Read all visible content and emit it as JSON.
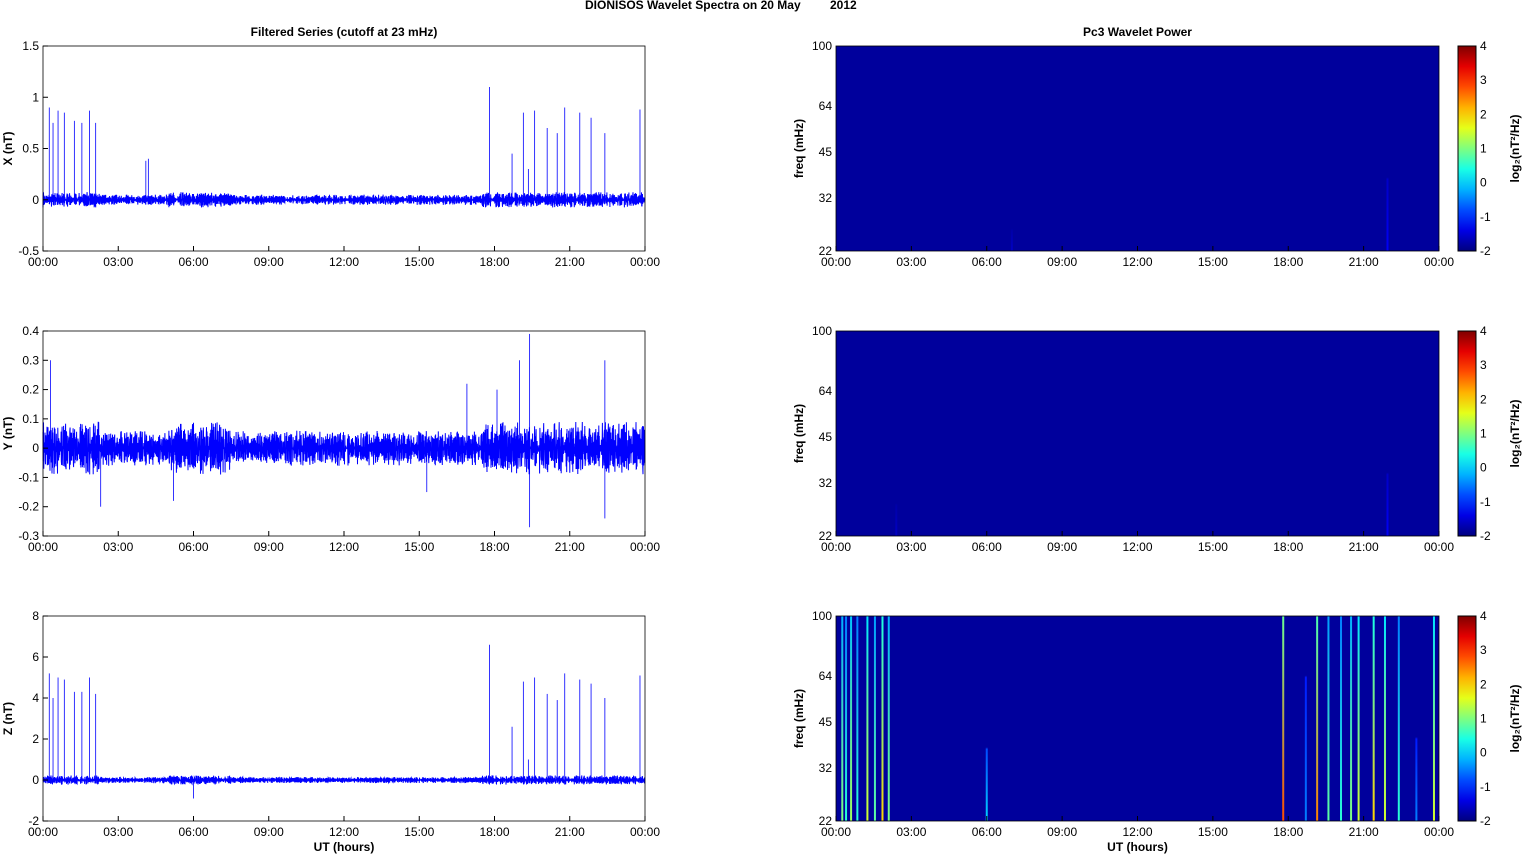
{
  "title": "DIONISOS Wavelet Spectra on 20 May",
  "year": "2012",
  "chart_data": [
    {
      "type": "line",
      "title": "Filtered Series (cutoff at 23 mHz)",
      "ylabel": "X (nT)",
      "xlabel": "",
      "ylim": [
        -0.5,
        1.5
      ],
      "yticks": [
        "-0.5",
        "0",
        "0.5",
        "1",
        "1.5"
      ],
      "xticks": [
        "00:00",
        "03:00",
        "06:00",
        "09:00",
        "12:00",
        "15:00",
        "18:00",
        "21:00",
        "00:00"
      ],
      "noise": 0.05,
      "color": "#0000ff",
      "spikes": [
        [
          0.25,
          0.9
        ],
        [
          0.4,
          0.75
        ],
        [
          0.6,
          0.87
        ],
        [
          0.85,
          0.85
        ],
        [
          1.25,
          0.77
        ],
        [
          1.55,
          0.75
        ],
        [
          1.85,
          0.87
        ],
        [
          2.1,
          0.75
        ],
        [
          4.1,
          0.38
        ],
        [
          4.2,
          0.4
        ],
        [
          17.8,
          1.1
        ],
        [
          18.7,
          0.45
        ],
        [
          19.15,
          0.85
        ],
        [
          19.35,
          0.3
        ],
        [
          19.6,
          0.87
        ],
        [
          20.1,
          0.7
        ],
        [
          20.5,
          0.65
        ],
        [
          20.8,
          0.9
        ],
        [
          21.4,
          0.85
        ],
        [
          21.85,
          0.8
        ],
        [
          22.4,
          0.65
        ],
        [
          23.8,
          0.88
        ]
      ]
    },
    {
      "type": "line",
      "title": "",
      "ylabel": "Y (nT)",
      "xlabel": "",
      "ylim": [
        -0.3,
        0.4
      ],
      "yticks": [
        "-0.3",
        "-0.2",
        "-0.1",
        "0",
        "0.1",
        "0.2",
        "0.3",
        "0.4"
      ],
      "xticks": [
        "00:00",
        "03:00",
        "06:00",
        "09:00",
        "12:00",
        "15:00",
        "18:00",
        "21:00",
        "00:00"
      ],
      "noise": 0.06,
      "color": "#0000ff",
      "spikes": [
        [
          0.3,
          0.3
        ],
        [
          2.3,
          -0.2
        ],
        [
          5.2,
          -0.18
        ],
        [
          15.3,
          -0.15
        ],
        [
          16.9,
          0.22
        ],
        [
          18.1,
          0.2
        ],
        [
          19.0,
          0.3
        ],
        [
          19.4,
          0.39
        ],
        [
          19.4,
          -0.27
        ],
        [
          22.4,
          0.3
        ],
        [
          22.4,
          -0.24
        ]
      ]
    },
    {
      "type": "line",
      "title": "",
      "ylabel": "Z (nT)",
      "xlabel": "UT (hours)",
      "ylim": [
        -2,
        8
      ],
      "yticks": [
        "-2",
        "0",
        "2",
        "4",
        "6",
        "8"
      ],
      "xticks": [
        "00:00",
        "03:00",
        "06:00",
        "09:00",
        "12:00",
        "15:00",
        "18:00",
        "21:00",
        "00:00"
      ],
      "noise": 0.15,
      "color": "#0000ff",
      "spikes": [
        [
          0.25,
          5.2
        ],
        [
          0.4,
          4.0
        ],
        [
          0.6,
          5.0
        ],
        [
          0.85,
          4.9
        ],
        [
          1.25,
          4.3
        ],
        [
          1.55,
          4.3
        ],
        [
          1.85,
          5.0
        ],
        [
          2.1,
          4.2
        ],
        [
          6.0,
          -0.9
        ],
        [
          17.8,
          6.6
        ],
        [
          18.7,
          2.6
        ],
        [
          19.15,
          4.8
        ],
        [
          19.35,
          1.0
        ],
        [
          19.6,
          5.0
        ],
        [
          20.1,
          4.2
        ],
        [
          20.5,
          3.9
        ],
        [
          20.8,
          5.2
        ],
        [
          21.4,
          4.9
        ],
        [
          21.85,
          4.7
        ],
        [
          22.4,
          4.0
        ],
        [
          23.8,
          5.1
        ]
      ]
    },
    {
      "type": "heatmap",
      "title": "Pc3 Wavelet Power",
      "ylabel": "freq (mHz)",
      "xlabel": "",
      "yticks": [
        "100",
        "64",
        "45",
        "32",
        "22"
      ],
      "xticks": [
        "00:00",
        "03:00",
        "06:00",
        "09:00",
        "12:00",
        "15:00",
        "18:00",
        "21:00",
        "00:00"
      ],
      "colorbar": {
        "label": "log2(nT2/Hz)",
        "range": [
          -2,
          4
        ],
        "ticks": [
          "4",
          "3",
          "2",
          "1",
          "0",
          "-1",
          "-2"
        ]
      },
      "streaks": [
        [
          7.0,
          -1.6,
          0.1
        ],
        [
          21.95,
          -1.3,
          0.35
        ]
      ]
    },
    {
      "type": "heatmap",
      "title": "",
      "ylabel": "freq (mHz)",
      "xlabel": "",
      "yticks": [
        "100",
        "64",
        "45",
        "32",
        "22"
      ],
      "xticks": [
        "00:00",
        "03:00",
        "06:00",
        "09:00",
        "12:00",
        "15:00",
        "18:00",
        "21:00",
        "00:00"
      ],
      "colorbar": {
        "label": "log2(nT2/Hz)",
        "range": [
          -2,
          4
        ],
        "ticks": [
          "4",
          "3",
          "2",
          "1",
          "0",
          "-1",
          "-2"
        ]
      },
      "streaks": [
        [
          2.4,
          -1.6,
          0.15
        ],
        [
          21.95,
          -1.3,
          0.3
        ]
      ]
    },
    {
      "type": "heatmap",
      "title": "",
      "ylabel": "freq (mHz)",
      "xlabel": "UT (hours)",
      "yticks": [
        "100",
        "64",
        "45",
        "32",
        "22"
      ],
      "xticks": [
        "00:00",
        "03:00",
        "06:00",
        "09:00",
        "12:00",
        "15:00",
        "18:00",
        "21:00",
        "00:00"
      ],
      "colorbar": {
        "label": "log2(nT2/Hz)",
        "range": [
          -2,
          4
        ],
        "ticks": [
          "4",
          "3",
          "2",
          "1",
          "0",
          "-1",
          "-2"
        ]
      },
      "streaks": [
        [
          0.25,
          1.0,
          1
        ],
        [
          0.4,
          0.5,
          1
        ],
        [
          0.6,
          1.2,
          1
        ],
        [
          0.85,
          0.5,
          1
        ],
        [
          1.25,
          1.5,
          1
        ],
        [
          1.55,
          0.8,
          1
        ],
        [
          1.85,
          2.0,
          1
        ],
        [
          2.1,
          1.0,
          1
        ],
        [
          6.0,
          0.0,
          0.35
        ],
        [
          17.8,
          2.8,
          1
        ],
        [
          18.7,
          -0.5,
          0.7
        ],
        [
          19.15,
          2.5,
          1
        ],
        [
          19.6,
          0.8,
          1
        ],
        [
          20.1,
          0.5,
          1
        ],
        [
          20.5,
          1.0,
          1
        ],
        [
          20.8,
          1.5,
          1
        ],
        [
          21.4,
          2.0,
          1
        ],
        [
          21.85,
          1.5,
          1
        ],
        [
          22.4,
          0.5,
          1
        ],
        [
          23.1,
          -0.5,
          0.4
        ],
        [
          23.8,
          1.5,
          1
        ]
      ]
    }
  ]
}
